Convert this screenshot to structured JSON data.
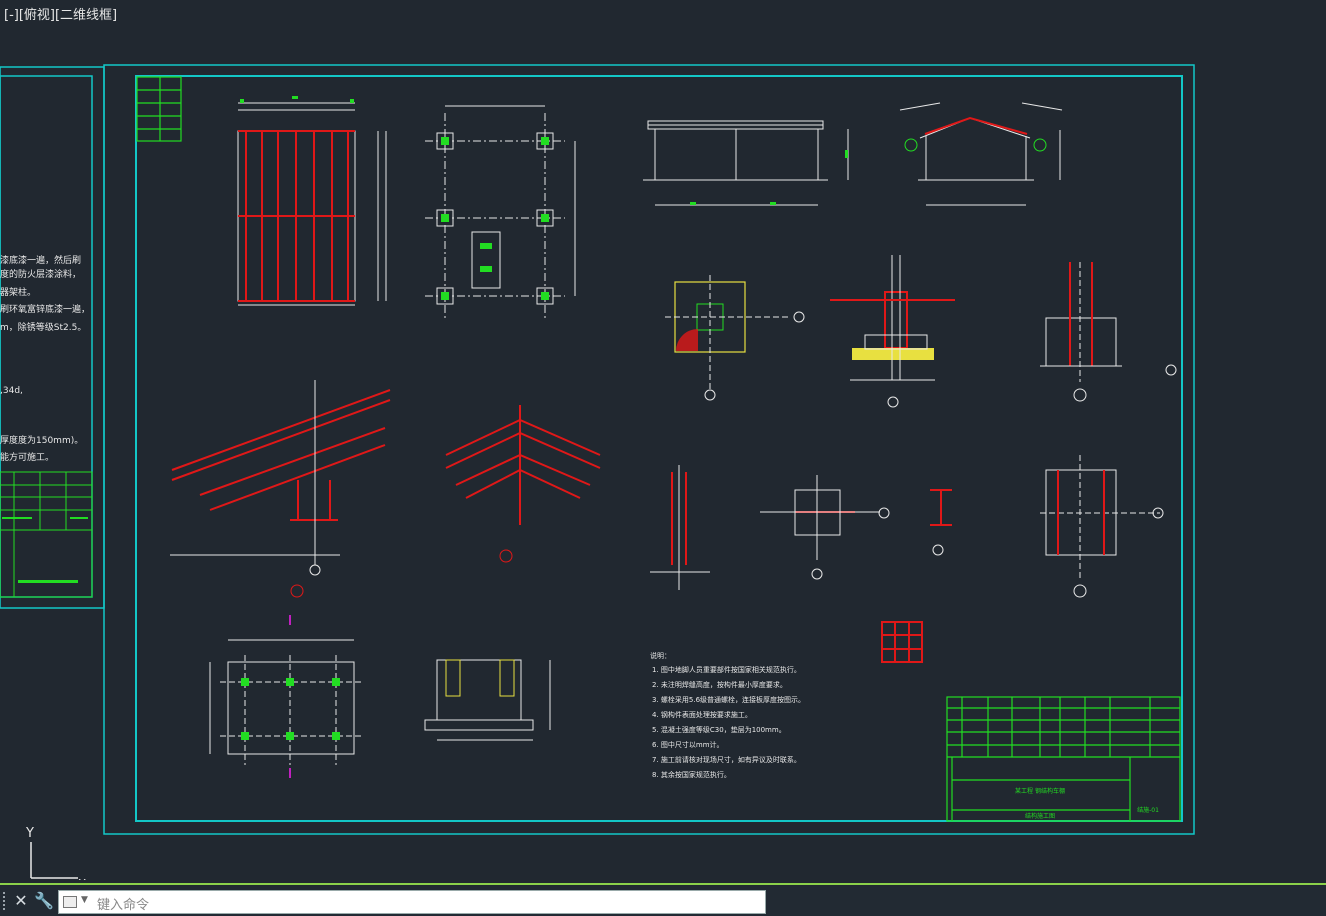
{
  "viewport": {
    "label": "[-][俯视][二维线框]"
  },
  "command_line": {
    "placeholder": "键入命令"
  },
  "ucs": {
    "y_label": "Y",
    "x_label": "X"
  },
  "left_sheet_notes": [
    "漆底漆一遍，然后刷",
    "度的防火层漆涂料，",
    "器架柱。",
    "刷环氧富锌底漆一遍，",
    "m，除锈等级St2.5。",
    ",34d,",
    "厚度度为150mm)。",
    "能方可施工。"
  ],
  "notes": {
    "heading": "说明：",
    "lines": [
      "1. 图中地脚人员重要部件按国家相关规范执行。",
      "2. 未注明焊缝高度，按构件最小厚度要求。",
      "3. 螺栓采用5.6级普通螺栓，连接板厚度按图示。",
      "4. 钢构件表面处理按要求施工。",
      "5. 混凝土强度等级C30，垫层为100mm。",
      "6. 图中尺寸以mm计。",
      "7. 施工前请核对现场尺寸，如有异议及时联系。",
      "8. 其余按国家规范执行。"
    ]
  },
  "title_block": {
    "project": "某工程 钢结构车棚",
    "drawing_name": "结构施工图",
    "drawing_no": "结施-01"
  },
  "colors": {
    "background": "#212830",
    "frame": "#13c7c7",
    "drawing_lines": "#e8e8e8",
    "members": "#e01818",
    "title_block": "#22dd22",
    "steel_fill": "#ffff00",
    "accent": "#8bd14a"
  }
}
